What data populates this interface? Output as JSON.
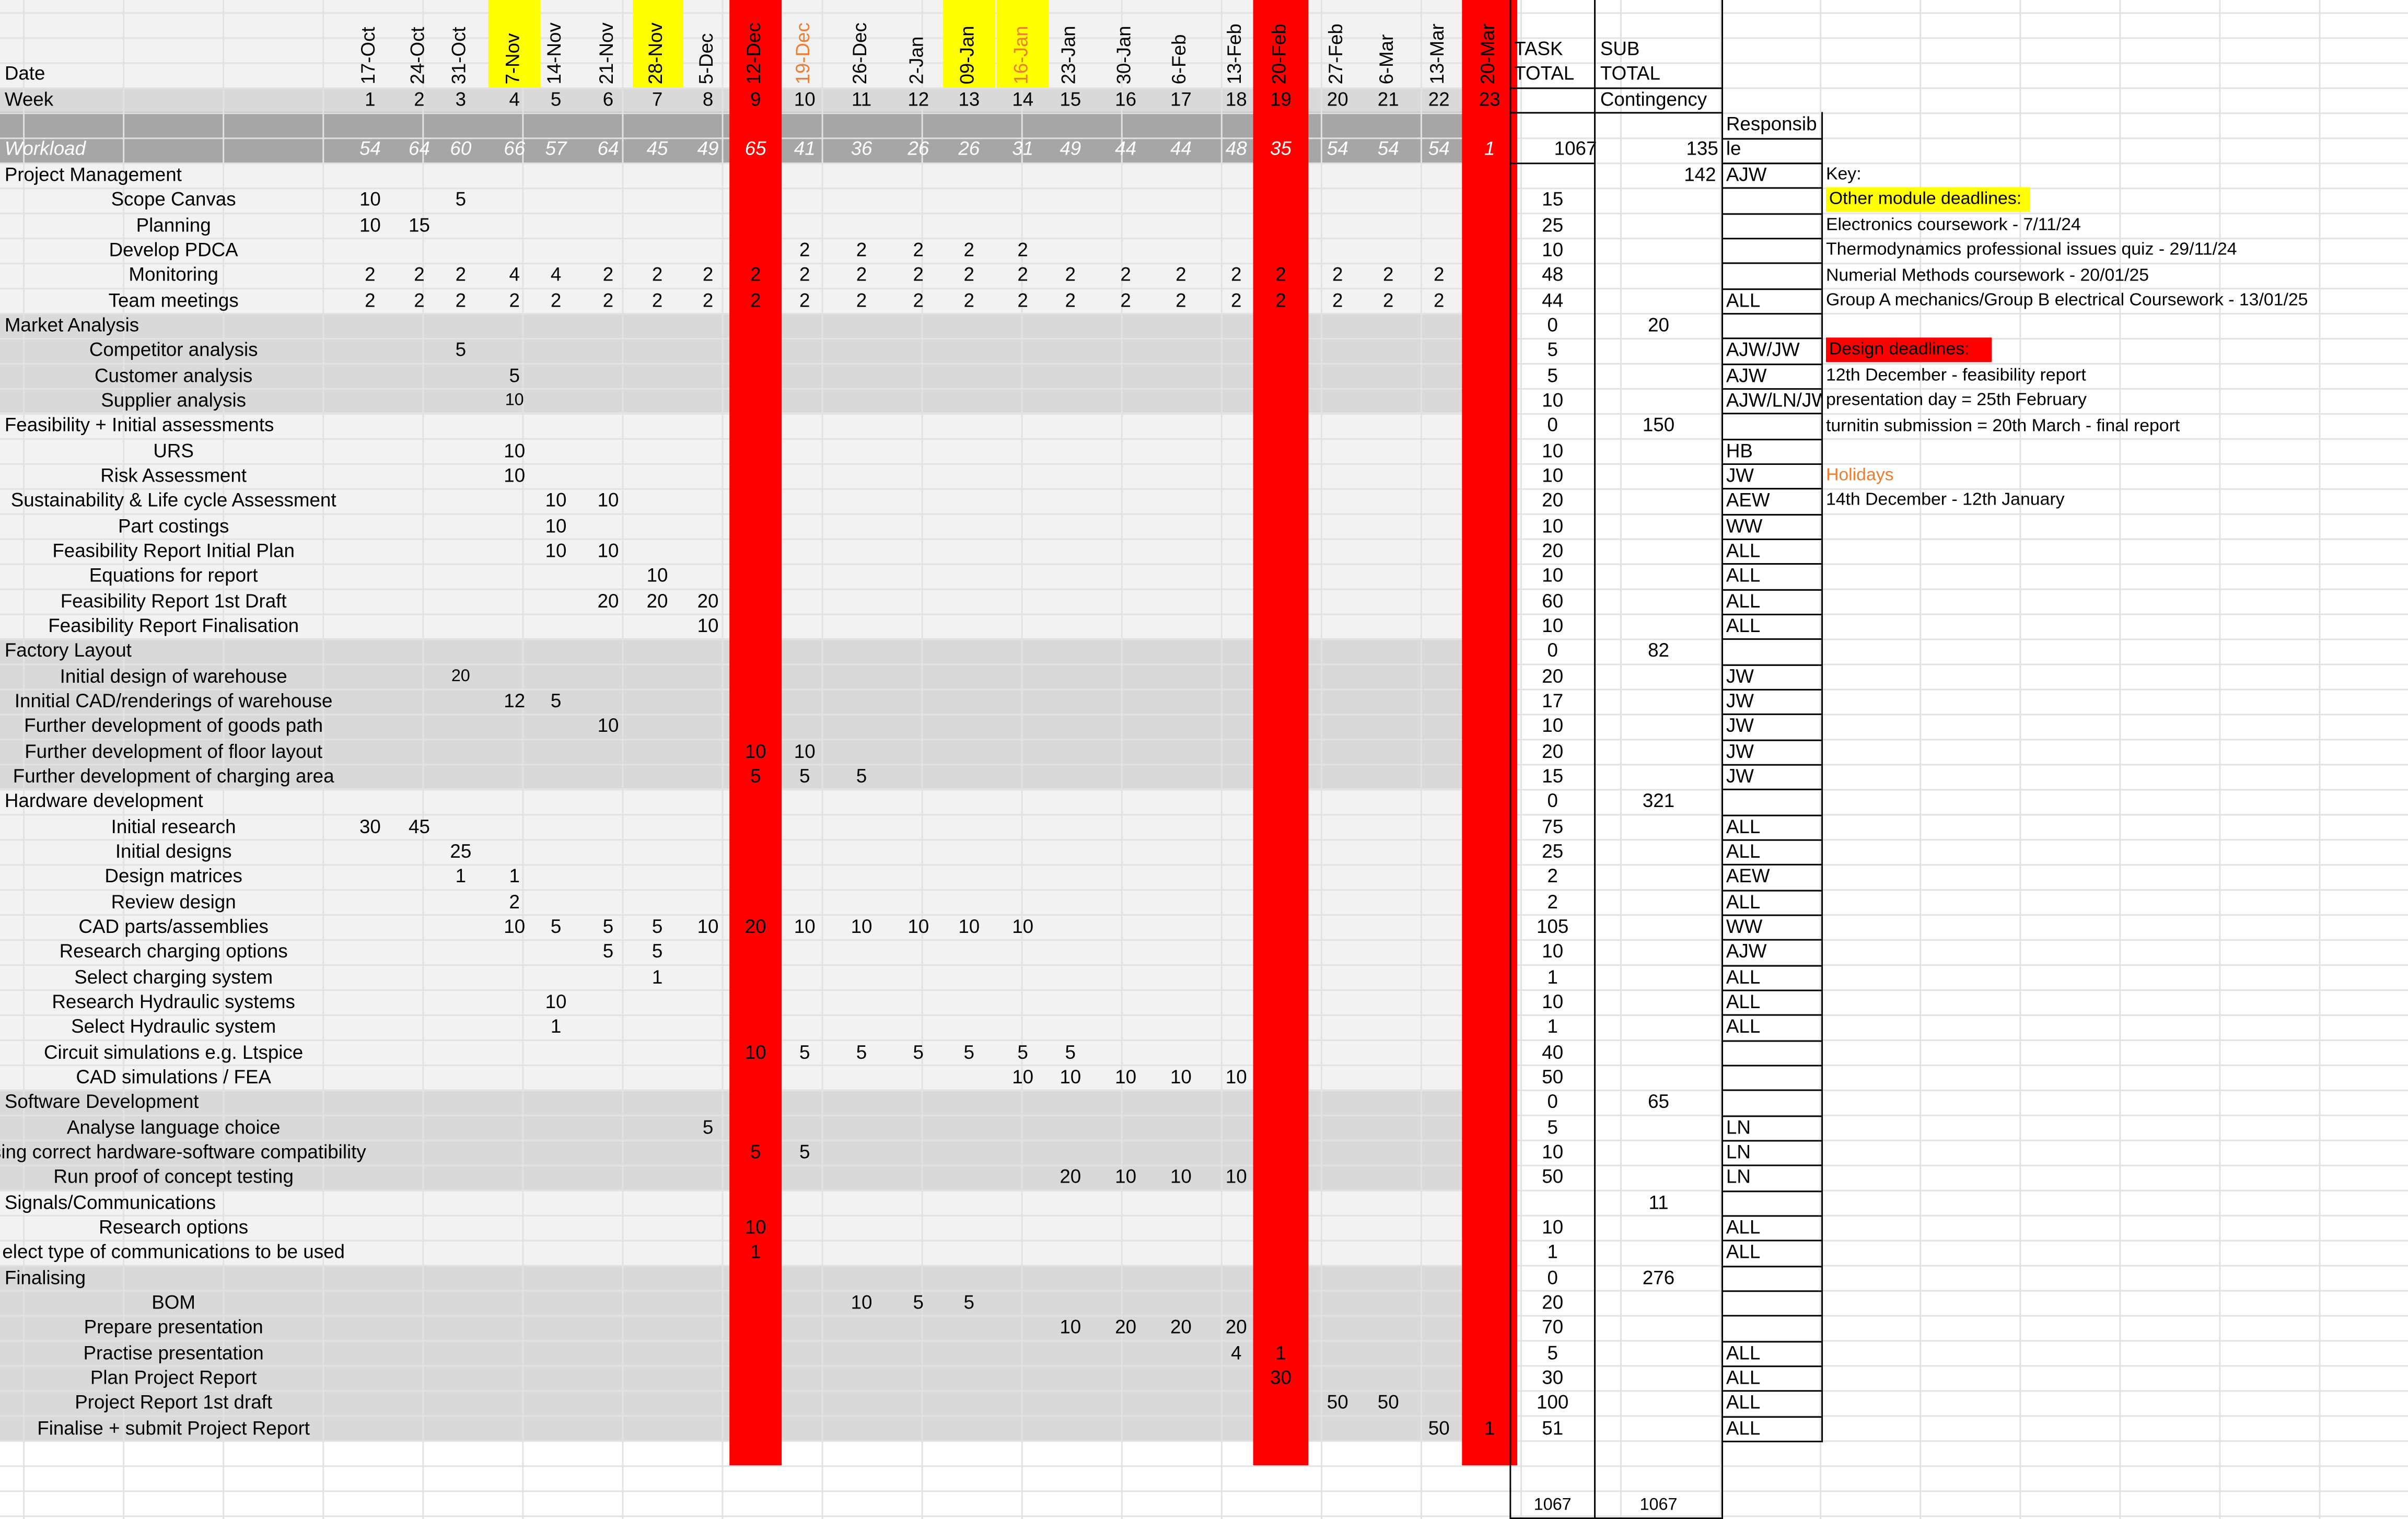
{
  "header": {
    "date_label": "Date",
    "week_label": "Week",
    "workload_label": "Workload",
    "task_total_label": [
      "TASK",
      "TOTAL"
    ],
    "sub_total_label": [
      "SUB",
      "TOTAL"
    ],
    "contingency_label": "Contingency",
    "responsible_label": [
      "Responsib",
      "le"
    ]
  },
  "weeks": [
    {
      "date": "17-Oct",
      "week": "1",
      "workload": "54",
      "style": "normal"
    },
    {
      "date": "24-Oct",
      "week": "2",
      "workload": "64",
      "style": "normal"
    },
    {
      "date": "31-Oct",
      "week": "3",
      "workload": "60",
      "style": "normal"
    },
    {
      "date": "7-Nov",
      "week": "4",
      "workload": "66",
      "style": "yellow"
    },
    {
      "date": "14-Nov",
      "week": "5",
      "workload": "57",
      "style": "normal"
    },
    {
      "date": "21-Nov",
      "week": "6",
      "workload": "64",
      "style": "normal"
    },
    {
      "date": "28-Nov",
      "week": "7",
      "workload": "45",
      "style": "yellow"
    },
    {
      "date": "5-Dec",
      "week": "8",
      "workload": "49",
      "style": "normal"
    },
    {
      "date": "12-Dec",
      "week": "9",
      "workload": "65",
      "style": "red"
    },
    {
      "date": "19-Dec",
      "week": "10",
      "workload": "41",
      "style": "holiday"
    },
    {
      "date": "26-Dec",
      "week": "11",
      "workload": "36",
      "style": "normal"
    },
    {
      "date": "2-Jan",
      "week": "12",
      "workload": "26",
      "style": "normal"
    },
    {
      "date": "09-Jan",
      "week": "13",
      "workload": "26",
      "style": "yellow"
    },
    {
      "date": "16-Jan",
      "week": "14",
      "workload": "31",
      "style": "yellow-holiday"
    },
    {
      "date": "23-Jan",
      "week": "15",
      "workload": "49",
      "style": "normal"
    },
    {
      "date": "30-Jan",
      "week": "16",
      "workload": "44",
      "style": "normal"
    },
    {
      "date": "6-Feb",
      "week": "17",
      "workload": "44",
      "style": "normal"
    },
    {
      "date": "13-Feb",
      "week": "18",
      "workload": "48",
      "style": "normal"
    },
    {
      "date": "20-Feb",
      "week": "19",
      "workload": "35",
      "style": "red"
    },
    {
      "date": "27-Feb",
      "week": "20",
      "workload": "54",
      "style": "normal"
    },
    {
      "date": "6-Mar",
      "week": "21",
      "workload": "54",
      "style": "normal"
    },
    {
      "date": "13-Mar",
      "week": "22",
      "workload": "54",
      "style": "normal"
    },
    {
      "date": "20-Mar",
      "week": "23",
      "workload": "1",
      "style": "red"
    }
  ],
  "workload_total": "1067",
  "contingency_total": "135",
  "rows": [
    {
      "label": "Project Management",
      "indent": "left",
      "section": true,
      "band": "light",
      "values": {},
      "task_total": "",
      "sub_total": "142",
      "resp": "AJW"
    },
    {
      "label": "Scope Canvas",
      "band": "light",
      "values": {
        "1": "10",
        "3": "5"
      },
      "task_total": "15",
      "sub_total": "",
      "resp": ""
    },
    {
      "label": "Planning",
      "band": "light",
      "values": {
        "1": "10",
        "2": "15"
      },
      "task_total": "25",
      "sub_total": "",
      "resp": ""
    },
    {
      "label": "Develop PDCA",
      "band": "light",
      "values": {
        "10": "2",
        "11": "2",
        "12": "2",
        "13": "2",
        "14": "2"
      },
      "task_total": "10",
      "sub_total": "",
      "resp": ""
    },
    {
      "label": "Monitoring",
      "band": "light",
      "values": {
        "1": "2",
        "2": "2",
        "3": "2",
        "4": "4",
        "5": "4",
        "6": "2",
        "7": "2",
        "8": "2",
        "9": "2",
        "10": "2",
        "11": "2",
        "12": "2",
        "13": "2",
        "14": "2",
        "15": "2",
        "16": "2",
        "17": "2",
        "18": "2",
        "19": "2",
        "20": "2",
        "21": "2",
        "22": "2"
      },
      "task_total": "48",
      "sub_total": "",
      "resp": ""
    },
    {
      "label": "Team meetings",
      "band": "light",
      "values": {
        "1": "2",
        "2": "2",
        "3": "2",
        "4": "2",
        "5": "2",
        "6": "2",
        "7": "2",
        "8": "2",
        "9": "2",
        "10": "2",
        "11": "2",
        "12": "2",
        "13": "2",
        "14": "2",
        "15": "2",
        "16": "2",
        "17": "2",
        "18": "2",
        "19": "2",
        "20": "2",
        "21": "2",
        "22": "2"
      },
      "task_total": "44",
      "sub_total": "",
      "resp": "ALL"
    },
    {
      "label": "Market Analysis",
      "indent": "left",
      "section": true,
      "band": "dark",
      "values": {},
      "task_total": "0",
      "sub_total": "20",
      "resp": ""
    },
    {
      "label": "Competitor analysis",
      "band": "dark",
      "values": {
        "3": "5"
      },
      "task_total": "5",
      "sub_total": "",
      "resp": "AJW/JW"
    },
    {
      "label": "Customer analysis",
      "band": "dark",
      "values": {
        "4": "5"
      },
      "task_total": "5",
      "sub_total": "",
      "resp": "AJW"
    },
    {
      "label": "Supplier analysis",
      "band": "dark",
      "values": {
        "4": "10"
      },
      "task_total": "10",
      "sub_total": "",
      "resp": "AJW/LN/JW"
    },
    {
      "label": "Feasibility + Initial assessments",
      "indent": "left",
      "section": true,
      "band": "light",
      "values": {},
      "task_total": "0",
      "sub_total": "150",
      "resp": ""
    },
    {
      "label": "URS",
      "band": "light",
      "values": {
        "4": "10"
      },
      "task_total": "10",
      "sub_total": "",
      "resp": "HB"
    },
    {
      "label": "Risk Assessment",
      "band": "light",
      "values": {
        "4": "10"
      },
      "task_total": "10",
      "sub_total": "",
      "resp": "JW"
    },
    {
      "label": "Sustainability & Life cycle Assessment",
      "band": "light",
      "values": {
        "5": "10",
        "6": "10"
      },
      "task_total": "20",
      "sub_total": "",
      "resp": "AEW"
    },
    {
      "label": "Part costings",
      "band": "light",
      "values": {
        "5": "10"
      },
      "task_total": "10",
      "sub_total": "",
      "resp": "WW"
    },
    {
      "label": "Feasibility Report Initial Plan",
      "band": "light",
      "values": {
        "5": "10",
        "6": "10"
      },
      "task_total": "20",
      "sub_total": "",
      "resp": "ALL"
    },
    {
      "label": "Equations for report",
      "band": "light",
      "values": {
        "7": "10"
      },
      "task_total": "10",
      "sub_total": "",
      "resp": "ALL"
    },
    {
      "label": "Feasibility Report 1st Draft",
      "band": "light",
      "values": {
        "6": "20",
        "7": "20",
        "8": "20"
      },
      "task_total": "60",
      "sub_total": "",
      "resp": "ALL"
    },
    {
      "label": "Feasibility Report Finalisation",
      "band": "light",
      "values": {
        "8": "10"
      },
      "task_total": "10",
      "sub_total": "",
      "resp": "ALL"
    },
    {
      "label": "Factory Layout",
      "indent": "left",
      "section": true,
      "band": "dark",
      "values": {},
      "task_total": "0",
      "sub_total": "82",
      "resp": ""
    },
    {
      "label": "Initial design of warehouse",
      "band": "dark",
      "values": {
        "3": "20"
      },
      "task_total": "20",
      "sub_total": "",
      "resp": "JW"
    },
    {
      "label": "Innitial CAD/renderings of warehouse",
      "band": "dark",
      "values": {
        "4": "12",
        "5": "5"
      },
      "task_total": "17",
      "sub_total": "",
      "resp": "JW"
    },
    {
      "label": "Further development of goods path",
      "band": "dark",
      "values": {
        "6": "10"
      },
      "task_total": "10",
      "sub_total": "",
      "resp": "JW"
    },
    {
      "label": "Further development of floor layout",
      "band": "dark",
      "values": {
        "9": "10",
        "10": "10"
      },
      "task_total": "20",
      "sub_total": "",
      "resp": "JW"
    },
    {
      "label": "Further development of charging area",
      "band": "dark",
      "values": {
        "9": "5",
        "10": "5",
        "11": "5"
      },
      "task_total": "15",
      "sub_total": "",
      "resp": "JW"
    },
    {
      "label": "Hardware development",
      "indent": "left",
      "section": true,
      "band": "light",
      "values": {},
      "task_total": "0",
      "sub_total": "321",
      "resp": ""
    },
    {
      "label": "Initial research",
      "band": "light",
      "values": {
        "1": "30",
        "2": "45"
      },
      "task_total": "75",
      "sub_total": "",
      "resp": "ALL"
    },
    {
      "label": "Initial designs",
      "band": "light",
      "values": {
        "3": "25"
      },
      "task_total": "25",
      "sub_total": "",
      "resp": "ALL"
    },
    {
      "label": "Design matrices",
      "band": "light",
      "values": {
        "3": "1",
        "4": "1"
      },
      "task_total": "2",
      "sub_total": "",
      "resp": "AEW"
    },
    {
      "label": "Review design",
      "band": "light",
      "values": {
        "4": "2"
      },
      "task_total": "2",
      "sub_total": "",
      "resp": "ALL"
    },
    {
      "label": "CAD parts/assemblies",
      "band": "light",
      "values": {
        "4": "10",
        "5": "5",
        "6": "5",
        "7": "5",
        "8": "10",
        "9": "20",
        "10": "10",
        "11": "10",
        "12": "10",
        "13": "10",
        "14": "10"
      },
      "task_total": "105",
      "sub_total": "",
      "resp": "WW"
    },
    {
      "label": "Research charging options",
      "band": "light",
      "values": {
        "6": "5",
        "7": "5"
      },
      "task_total": "10",
      "sub_total": "",
      "resp": "AJW"
    },
    {
      "label": "Select charging system",
      "band": "light",
      "values": {
        "7": "1"
      },
      "task_total": "1",
      "sub_total": "",
      "resp": "ALL"
    },
    {
      "label": "Research Hydraulic systems",
      "band": "light",
      "values": {
        "5": "10"
      },
      "task_total": "10",
      "sub_total": "",
      "resp": "ALL"
    },
    {
      "label": "Select Hydraulic system",
      "band": "light",
      "values": {
        "5": "1"
      },
      "task_total": "1",
      "sub_total": "",
      "resp": "ALL"
    },
    {
      "label": "Circuit simulations e.g. Ltspice",
      "band": "light",
      "values": {
        "9": "10",
        "10": "5",
        "11": "5",
        "12": "5",
        "13": "5",
        "14": "5",
        "15": "5"
      },
      "task_total": "40",
      "sub_total": "",
      "resp": ""
    },
    {
      "label": "CAD simulations / FEA",
      "band": "light",
      "values": {
        "14": "10",
        "15": "10",
        "16": "10",
        "17": "10",
        "18": "10"
      },
      "task_total": "50",
      "sub_total": "",
      "resp": ""
    },
    {
      "label": "Software Development",
      "indent": "left",
      "section": true,
      "band": "dark",
      "values": {},
      "task_total": "0",
      "sub_total": "65",
      "resp": ""
    },
    {
      "label": "Analyse language choice",
      "band": "dark",
      "values": {
        "8": "5"
      },
      "task_total": "5",
      "sub_total": "",
      "resp": "LN"
    },
    {
      "label": "osing correct hardware-software compatibility",
      "band": "dark",
      "values": {
        "9": "5",
        "10": "5"
      },
      "task_total": "10",
      "sub_total": "",
      "resp": "LN"
    },
    {
      "label": "Run proof of concept testing",
      "band": "dark",
      "values": {
        "15": "20",
        "16": "10",
        "17": "10",
        "18": "10"
      },
      "task_total": "50",
      "sub_total": "",
      "resp": "LN"
    },
    {
      "label": "Signals/Communications",
      "indent": "left",
      "section": true,
      "band": "light",
      "values": {},
      "task_total": "",
      "sub_total": "11",
      "resp": ""
    },
    {
      "label": "Research options",
      "band": "light",
      "values": {
        "9": "10"
      },
      "task_total": "10",
      "sub_total": "",
      "resp": "ALL"
    },
    {
      "label": "elect type of communications to be used",
      "band": "light",
      "values": {
        "9": "1"
      },
      "task_total": "1",
      "sub_total": "",
      "resp": "ALL"
    },
    {
      "label": "Finalising",
      "indent": "left",
      "section": true,
      "band": "dark",
      "values": {},
      "task_total": "0",
      "sub_total": "276",
      "resp": ""
    },
    {
      "label": "BOM",
      "band": "dark",
      "values": {
        "11": "10",
        "12": "5",
        "13": "5"
      },
      "task_total": "20",
      "sub_total": "",
      "resp": ""
    },
    {
      "label": "Prepare presentation",
      "band": "dark",
      "values": {
        "15": "10",
        "16": "20",
        "17": "20",
        "18": "20"
      },
      "task_total": "70",
      "sub_total": "",
      "resp": ""
    },
    {
      "label": "Practise presentation",
      "band": "dark",
      "values": {
        "18": "4",
        "19": "1"
      },
      "task_total": "5",
      "sub_total": "",
      "resp": "ALL"
    },
    {
      "label": "Plan Project Report",
      "band": "dark",
      "values": {
        "19": "30"
      },
      "task_total": "30",
      "sub_total": "",
      "resp": "ALL"
    },
    {
      "label": "Project Report 1st draft",
      "band": "dark",
      "values": {
        "20": "50",
        "21": "50"
      },
      "task_total": "100",
      "sub_total": "",
      "resp": "ALL"
    },
    {
      "label": "Finalise + submit Project Report",
      "band": "dark",
      "values": {
        "22": "50",
        "23": "1"
      },
      "task_total": "51",
      "sub_total": "",
      "resp": "ALL"
    }
  ],
  "footer": {
    "task_total": "1067",
    "sub_total": "1067"
  },
  "key": {
    "title": "Key:",
    "other_label": "Other module deadlines:",
    "other_items": [
      "Electronics coursework - 7/11/24",
      "Thermodynamics professional issues quiz - 29/11/24",
      "Numerial Methods coursework - 20/01/25",
      "Group A mechanics/Group B electrical Coursework - 13/01/25"
    ],
    "design_label": "Design deadlines:",
    "design_items": [
      "12th December - feasibility report",
      "presentation day = 25th February",
      "turnitin submission = 20th March - final report"
    ],
    "holidays_label": "Holidays",
    "holidays_items": [
      "14th December - 12th January"
    ]
  },
  "colors": {
    "yellow": "#ffff00",
    "red": "#ff0000",
    "holiday": "#ed7d31",
    "workload_bg": "#a6a6a6"
  }
}
